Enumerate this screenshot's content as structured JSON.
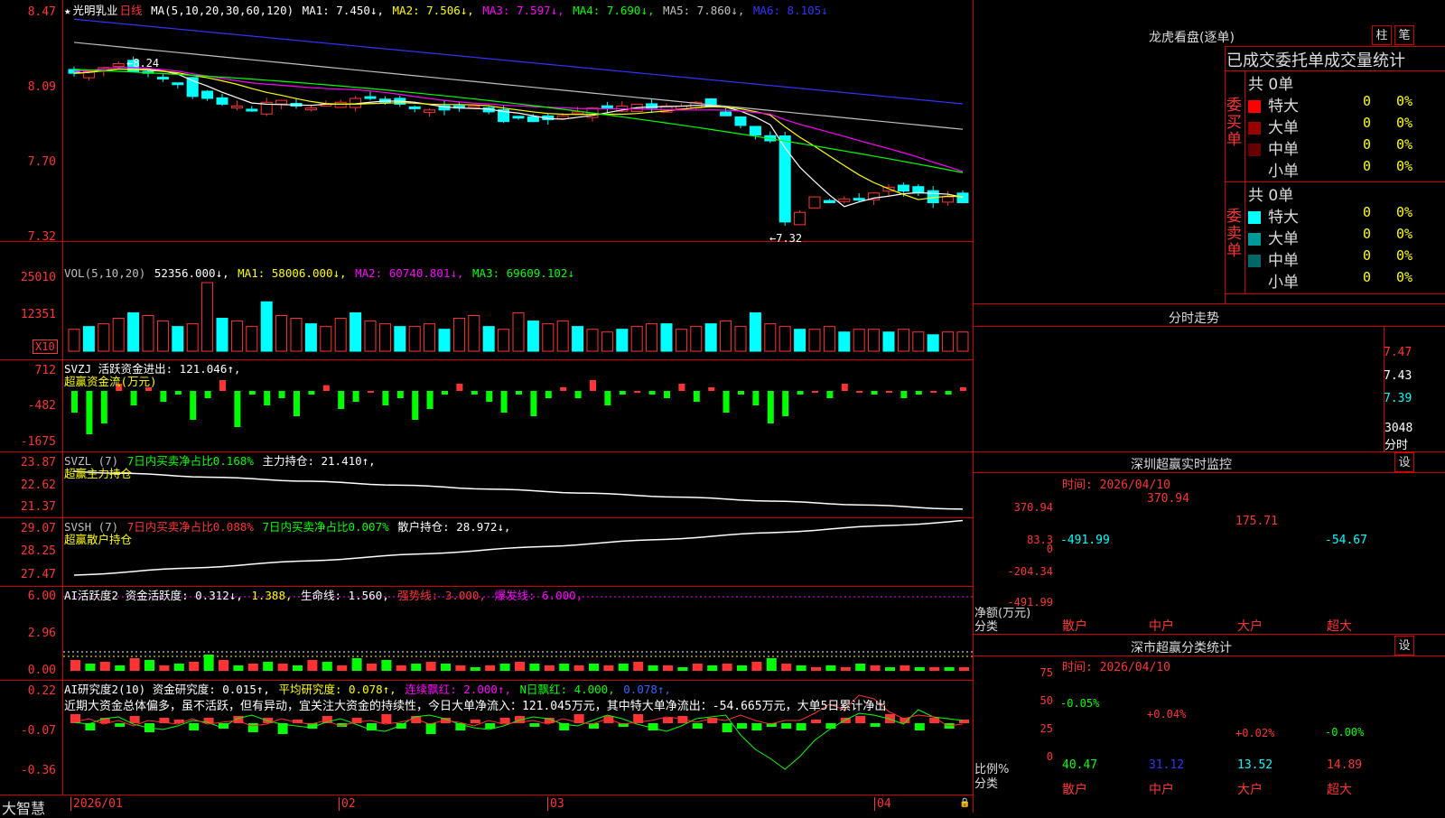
{
  "main_chart": {
    "star": "★",
    "stock_name": "光明乳业",
    "period": "日线",
    "ma_label": "MA(5,10,20,30,60,120)",
    "ma_items": [
      {
        "label": "MA1: 7.450↓,",
        "color": "#ffffff"
      },
      {
        "label": "MA2: 7.506↓,",
        "color": "#ffff00"
      },
      {
        "label": "MA3: 7.597↓,",
        "color": "#ff00ff"
      },
      {
        "label": "MA4: 7.690↓,",
        "color": "#00ff00"
      },
      {
        "label": "MA5: 7.860↓,",
        "color": "#c0c0c0"
      },
      {
        "label": "MA6: 8.105↓",
        "color": "#3333ff"
      }
    ],
    "y_labels": [
      "8.47",
      "8.09",
      "7.70",
      "7.32"
    ],
    "high_annotation": "←8.24",
    "low_annotation": "←7.32"
  },
  "volume": {
    "legend": [
      {
        "label": "VOL(5,10,20)",
        "color": "#c0c0c0"
      },
      {
        "label": "52356.000↓,",
        "color": "#ffffff"
      },
      {
        "label": "MA1: 58006.000↓,",
        "color": "#ffff00"
      },
      {
        "label": "MA2: 60740.801↓,",
        "color": "#ff00ff"
      },
      {
        "label": "MA3: 69609.102↓",
        "color": "#00ff00"
      }
    ],
    "y_labels": [
      "25010",
      "12351"
    ],
    "unit": "X10"
  },
  "svzj": {
    "legend": [
      {
        "label": "SVZJ  活跃资金进出: 121.046↑,",
        "color": "#ffffff"
      }
    ],
    "legend2": "超赢资金流(万元)",
    "y_labels": [
      "712",
      "-482",
      "-1675"
    ]
  },
  "svzl": {
    "legend": [
      {
        "label": "SVZL (7)",
        "color": "#c0c0c0"
      },
      {
        "label": "7日内买卖净占比0.168%",
        "color": "#00ff00"
      },
      {
        "label": "主力持仓: 21.410↑,",
        "color": "#ffffff"
      }
    ],
    "legend2": "超赢主力持仓",
    "y_labels": [
      "23.87",
      "22.62",
      "21.37"
    ]
  },
  "svsh": {
    "legend": [
      {
        "label": "SVSH (7)",
        "color": "#c0c0c0"
      },
      {
        "label": "7日内买卖净占比0.088%",
        "color": "#ff3333"
      },
      {
        "label": "7日内买卖净占比0.007%",
        "color": "#00ff00"
      },
      {
        "label": "散户持仓: 28.972↓,",
        "color": "#ffffff"
      }
    ],
    "legend2": "超赢散户持仓",
    "y_labels": [
      "29.07",
      "28.25",
      "27.47"
    ]
  },
  "ai_activity": {
    "legend": [
      {
        "label": "AI活跃度2 资金活跃度: 0.312↓,",
        "color": "#ffffff"
      },
      {
        "label": "1.388,",
        "color": "#ffff00"
      },
      {
        "label": "生命线: 1.560,",
        "color": "#ffffff"
      },
      {
        "label": "强势线: 3.000,",
        "color": "#ff3333"
      },
      {
        "label": "爆发线: 6.000,",
        "color": "#ff00ff"
      }
    ],
    "y_labels": [
      "6.00",
      "2.96",
      "0.00"
    ]
  },
  "ai_research": {
    "legend": [
      {
        "label": "AI研究度2(10) 资金研究度: 0.015↑,",
        "color": "#ffffff"
      },
      {
        "label": "平均研究度: 0.078↑,",
        "color": "#ffff00"
      },
      {
        "label": "连续飘红: 2.000↑,",
        "color": "#ff00ff"
      },
      {
        "label": "N日飘红: 4.000,",
        "color": "#00ff00"
      },
      {
        "label": "0.078↑,",
        "color": "#3366ff"
      }
    ],
    "comment": "近期大资金总体偏多，虽不活跃，但有异动，宜关注大资金的持续性，今日大单净流入：121.045万元，其中特大单净流出：-54.665万元，大单5日累计净出",
    "y_labels": [
      "0.22",
      "-0.07",
      "-0.36"
    ]
  },
  "bottom_bar": {
    "brand": "大智慧",
    "dates": [
      "2026/01",
      "02",
      "03",
      "04"
    ]
  },
  "right_panel": {
    "dragon_title": "龙虎看盘(逐单)",
    "btn_bar": "柱",
    "btn_pen": "笔",
    "stats_title": "已成交委托单成交量统计",
    "buy": {
      "side": "委买单",
      "total": "共 0单",
      "rows": [
        {
          "label": "特大",
          "vol": "0",
          "pct": "0%",
          "color": "#ff0000"
        },
        {
          "label": "大单",
          "vol": "0",
          "pct": "0%",
          "color": "#990000"
        },
        {
          "label": "中单",
          "vol": "0",
          "pct": "0%",
          "color": "#660000"
        },
        {
          "label": "小单",
          "vol": "0",
          "pct": "0%",
          "color": "#000000"
        }
      ]
    },
    "sell": {
      "side": "委卖单",
      "total": "共 0单",
      "rows": [
        {
          "label": "特大",
          "vol": "0",
          "pct": "0%",
          "color": "#00ffff"
        },
        {
          "label": "大单",
          "vol": "0",
          "pct": "0%",
          "color": "#009999"
        },
        {
          "label": "中单",
          "vol": "0",
          "pct": "0%",
          "color": "#006666"
        },
        {
          "label": "小单",
          "vol": "0",
          "pct": "0%",
          "color": "#000000"
        }
      ]
    },
    "intraday_title": "分时走势",
    "intraday_y": [
      "7.47",
      "7.43",
      "7.39"
    ],
    "intraday_vol": "3048",
    "intraday_unit": "分时",
    "sz_monitor_title": "深圳超赢实时监控",
    "sz_set": "设",
    "sz_time": "时间: 2026/04/10",
    "sz_y": [
      "370.94",
      "83.3",
      "0",
      "-204.34",
      "-491.99"
    ],
    "sz_values": [
      {
        "cat": "散户",
        "value": -491.99,
        "label": "-491.99",
        "color": "#00ffff"
      },
      {
        "cat": "中户",
        "value": 370.94,
        "label": "370.94",
        "color": "#ff3333"
      },
      {
        "cat": "大户",
        "value": 175.71,
        "label": "175.71",
        "color": "#ff3333"
      },
      {
        "cat": "超大",
        "value": -54.67,
        "label": "-54.67",
        "color": "#00ffff"
      }
    ],
    "sz_axis_name": "净额(万元)",
    "sz_cat_name": "分类",
    "cls_title": "深市超赢分类统计",
    "cls_set": "设",
    "cls_time": "时间: 2026/04/10",
    "cls_y": [
      "75",
      "50",
      "25",
      "0"
    ],
    "cls_values": [
      {
        "cat": "散户",
        "value": 40.47,
        "label": "40.47",
        "delta": "-0.05%",
        "delta_color": "#00ff00",
        "color": "#00ff00"
      },
      {
        "cat": "中户",
        "value": 31.12,
        "label": "31.12",
        "delta": "+0.04%",
        "delta_color": "#ff3333",
        "color": "#3333ff"
      },
      {
        "cat": "大户",
        "value": 13.52,
        "label": "13.52",
        "delta": "+0.02%",
        "delta_color": "#ff3333",
        "color": "#00ffff"
      },
      {
        "cat": "超大",
        "value": 14.89,
        "label": "14.89",
        "delta": "-0.00%",
        "delta_color": "#00ff00",
        "color": "#ff3333"
      }
    ],
    "cls_axis_name": "比例%",
    "cls_cat_name": "分类"
  }
}
